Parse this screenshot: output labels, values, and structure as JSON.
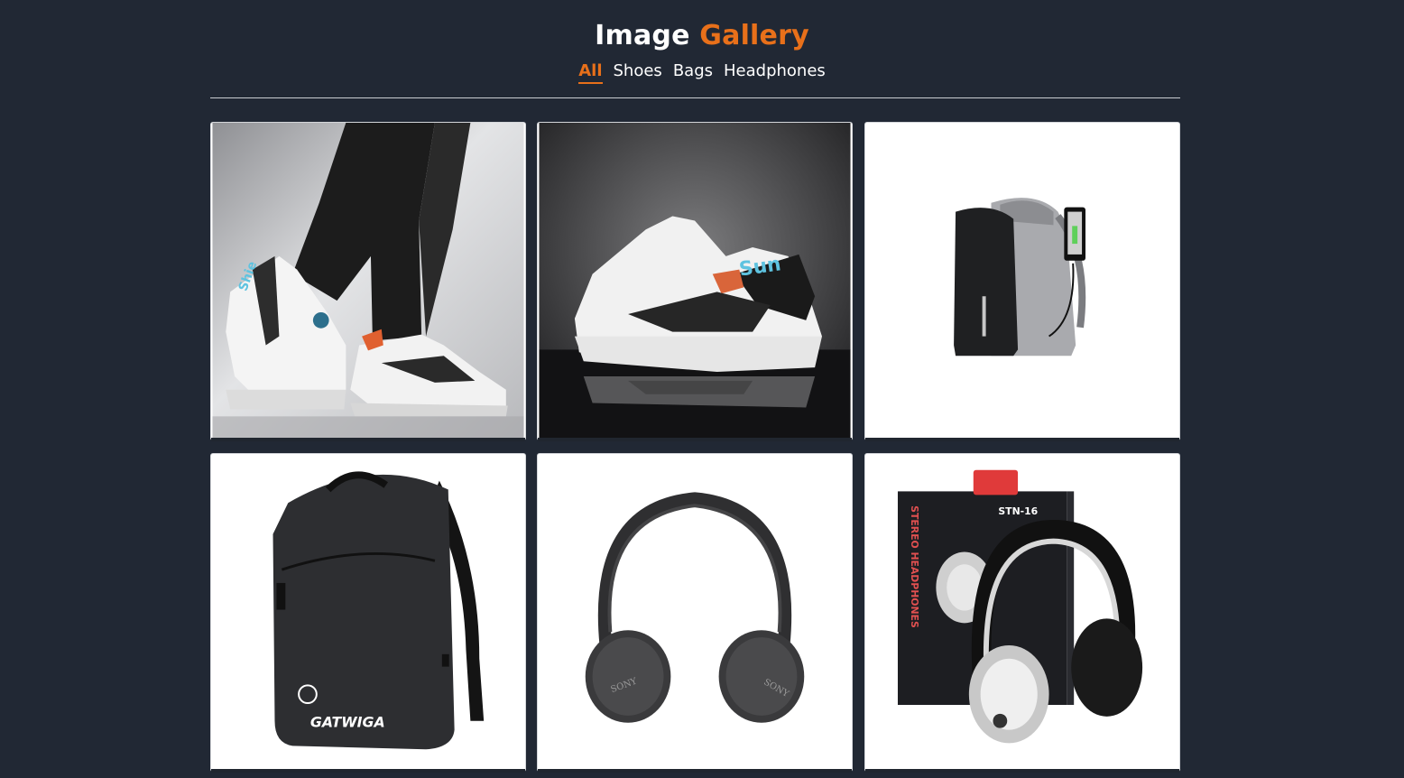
{
  "header": {
    "title_part1": "Image",
    "title_part2": "Gallery"
  },
  "filters": [
    {
      "label": "All",
      "active": true
    },
    {
      "label": "Shoes",
      "active": false
    },
    {
      "label": "Bags",
      "active": false
    },
    {
      "label": "Headphones",
      "active": false
    }
  ],
  "gallery": {
    "items": [
      {
        "category": "Shoes",
        "image_text": "Shie"
      },
      {
        "category": "Shoes",
        "image_text": "Sun"
      },
      {
        "category": "Bags",
        "image_text": ""
      },
      {
        "category": "Bags",
        "image_text": "GATWIGA"
      },
      {
        "category": "Headphones",
        "image_text": "SONY"
      },
      {
        "category": "Headphones",
        "image_text": "STN-16",
        "image_text2": "STEREO HEADPHONES"
      }
    ]
  },
  "colors": {
    "background": "#212834",
    "accent": "#e8701a",
    "text": "#ffffff"
  }
}
